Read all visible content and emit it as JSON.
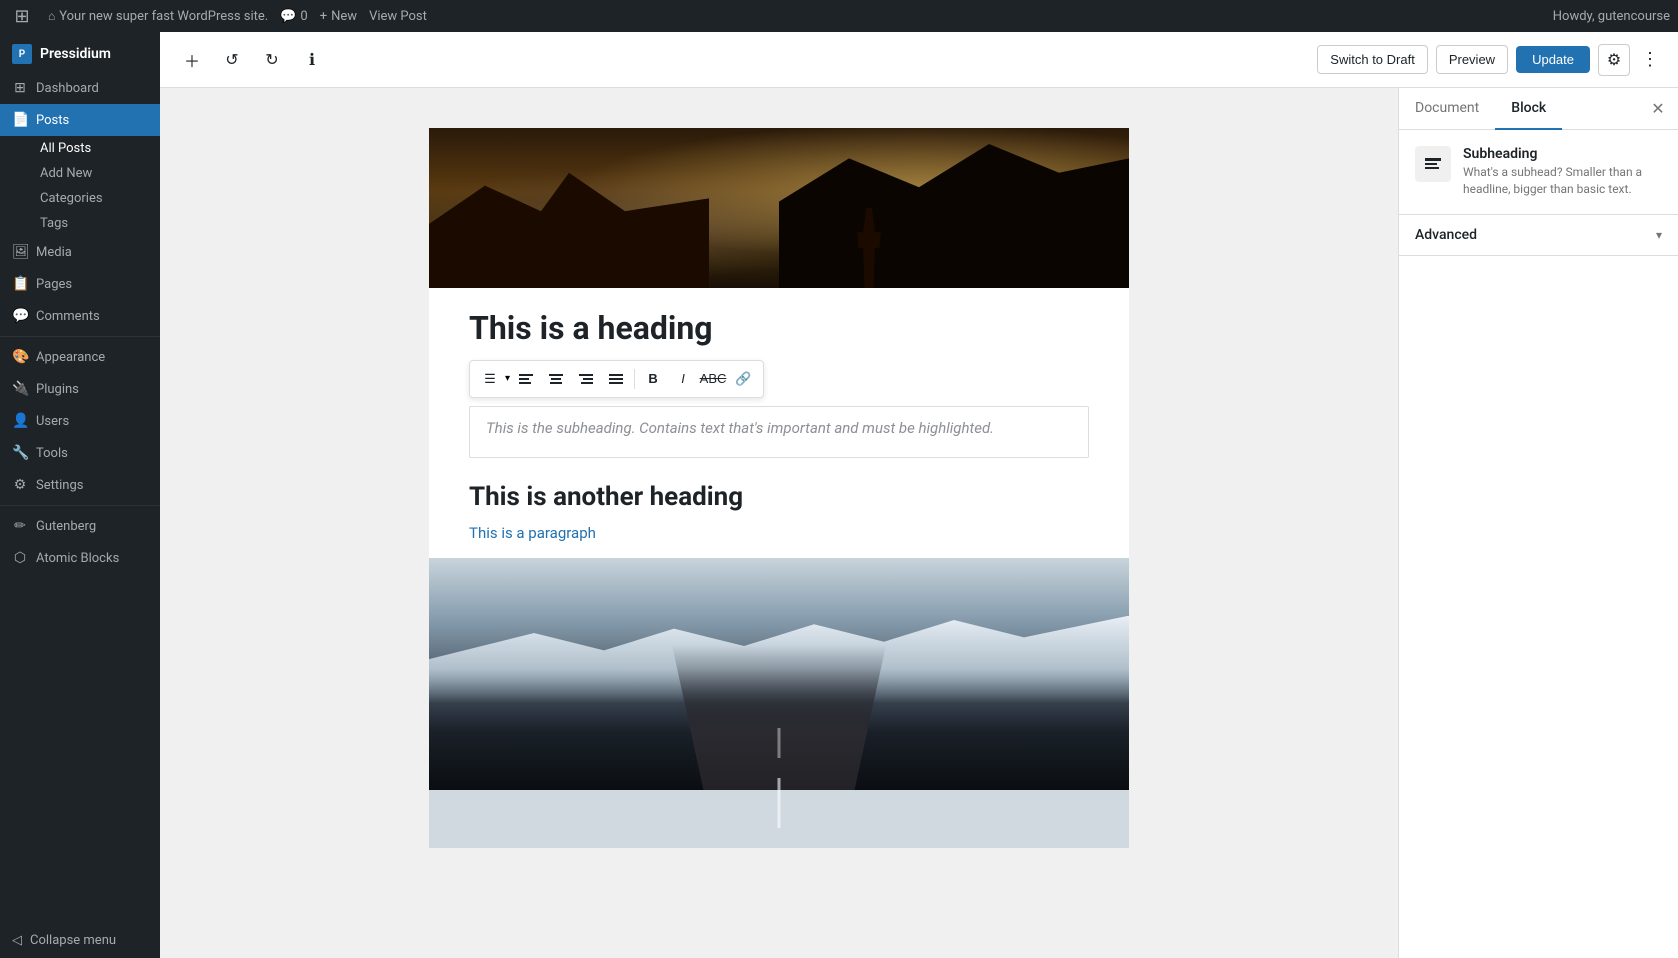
{
  "adminBar": {
    "siteName": "Your new super fast WordPress site.",
    "comments": "0",
    "new": "New",
    "viewPost": "View Post",
    "howdy": "Howdy, gutencourse"
  },
  "sidebar": {
    "brand": "Pressidium",
    "items": [
      {
        "label": "Dashboard",
        "icon": "⊞",
        "id": "dashboard"
      },
      {
        "label": "Posts",
        "icon": "📄",
        "id": "posts",
        "active": true
      },
      {
        "label": "Media",
        "icon": "🖼",
        "id": "media"
      },
      {
        "label": "Pages",
        "icon": "📋",
        "id": "pages"
      },
      {
        "label": "Comments",
        "icon": "💬",
        "id": "comments"
      },
      {
        "label": "Appearance",
        "icon": "🎨",
        "id": "appearance"
      },
      {
        "label": "Plugins",
        "icon": "🔌",
        "id": "plugins"
      },
      {
        "label": "Users",
        "icon": "👤",
        "id": "users"
      },
      {
        "label": "Tools",
        "icon": "🔧",
        "id": "tools"
      },
      {
        "label": "Settings",
        "icon": "⚙",
        "id": "settings"
      },
      {
        "label": "Gutenberg",
        "icon": "✏",
        "id": "gutenberg"
      },
      {
        "label": "Atomic Blocks",
        "icon": "⬡",
        "id": "atomic-blocks"
      }
    ],
    "postsSubmenu": [
      {
        "label": "All Posts",
        "id": "all-posts",
        "active": true
      },
      {
        "label": "Add New",
        "id": "add-new"
      },
      {
        "label": "Categories",
        "id": "categories"
      },
      {
        "label": "Tags",
        "id": "tags"
      }
    ],
    "collapseMenu": "Collapse menu"
  },
  "toolbar": {
    "switchToDraft": "Switch to Draft",
    "preview": "Preview",
    "update": "Update"
  },
  "content": {
    "heading1": "This is a heading",
    "subheadingPlaceholder": "This is the subheading. Contains text that's important and must be highlighted.",
    "heading2": "This is another heading",
    "paragraph": "This is a paragraph"
  },
  "rightPanel": {
    "documentTab": "Document",
    "blockTab": "Block",
    "blockTitle": "Subheading",
    "blockDesc": "What's a subhead? Smaller than a headline, bigger than basic text.",
    "advancedLabel": "Advanced"
  }
}
